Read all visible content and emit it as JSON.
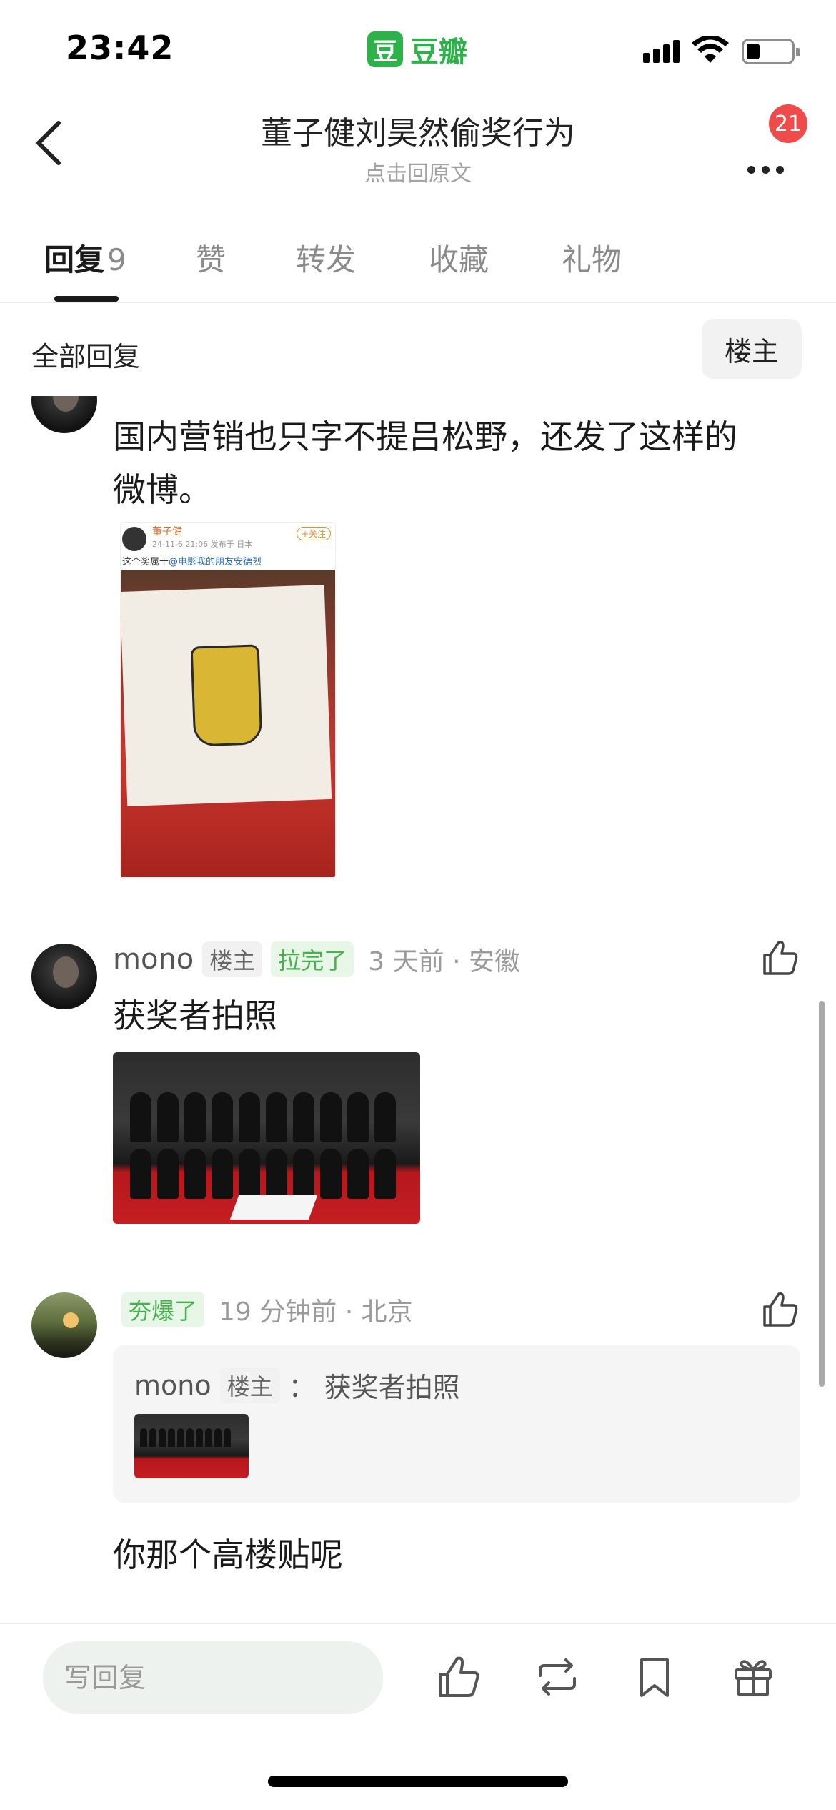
{
  "status": {
    "time": "23:42",
    "app_icon_char": "豆",
    "app_name": "豆瓣"
  },
  "header": {
    "title": "董子健刘昊然偷奖行为",
    "subtitle": "点击回原文",
    "notification_count": "21"
  },
  "tabs": [
    {
      "label": "回复",
      "count": "9",
      "active": true
    },
    {
      "label": "赞"
    },
    {
      "label": "转发"
    },
    {
      "label": "收藏"
    },
    {
      "label": "礼物"
    }
  ],
  "filter": {
    "label": "全部回复",
    "op_only": "楼主"
  },
  "comments": [
    {
      "text_line1": "国内营销也只字不提吕松野，还发了这样的",
      "text_line2": "微博。",
      "image": {
        "weibo_user": "董子健",
        "weibo_meta": "24-11-6 21:06 发布于 日本",
        "weibo_follow": "+关注",
        "weibo_caption_pre": "这个奖属于",
        "weibo_caption_at": "@电影我的朋友安德烈"
      }
    },
    {
      "username": "mono",
      "op_badge": "楼主",
      "tag": "拉完了",
      "time_location": "3 天前 · 安徽",
      "text": "获奖者拍照"
    },
    {
      "tag": "夯爆了",
      "time_location": "19 分钟前 · 北京",
      "quote": {
        "username": "mono",
        "op_badge": "楼主",
        "separator": "：",
        "text": "获奖者拍照"
      },
      "text": "你那个高楼贴呢"
    }
  ],
  "bottom_bar": {
    "reply_placeholder": "写回复"
  },
  "colors": {
    "brand_green": "#2db24a",
    "badge_red": "#ef4b4b",
    "tag_green": "#47b24d"
  }
}
